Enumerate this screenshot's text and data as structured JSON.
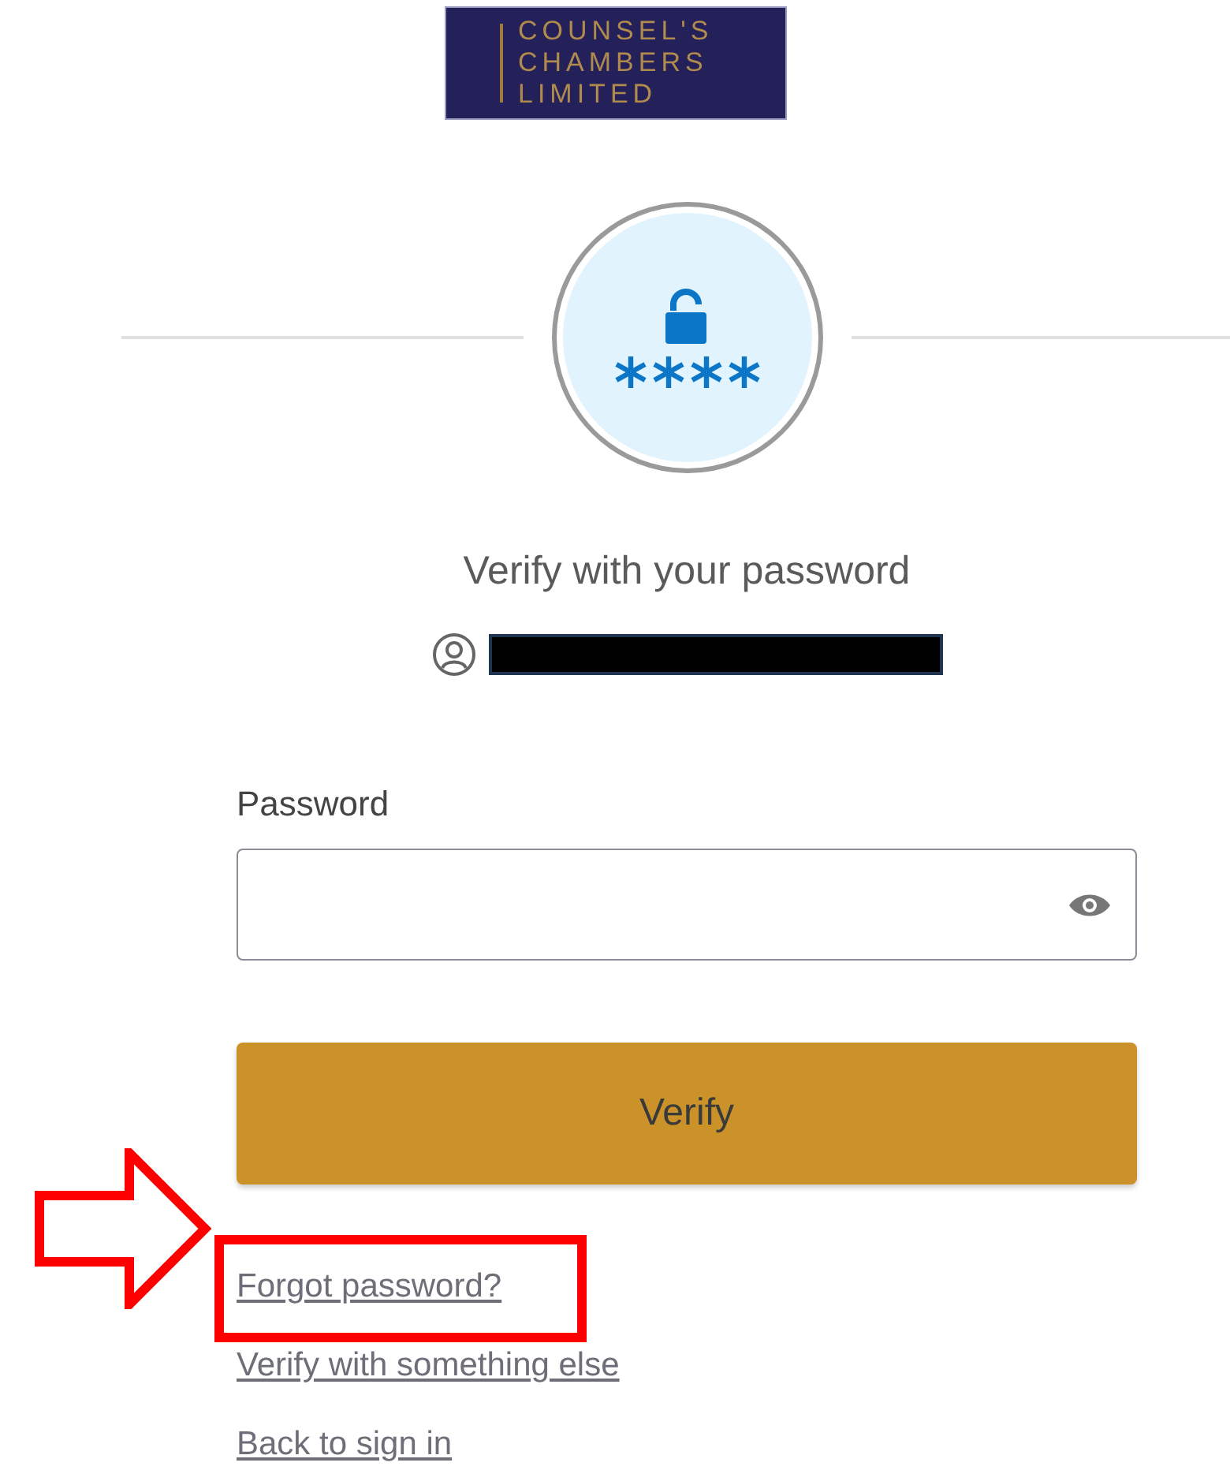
{
  "logo": {
    "lines": [
      "COUNSEL'S",
      "CHAMBERS",
      "LIMITED"
    ]
  },
  "title": "Verify with your password",
  "user": {
    "redacted": true
  },
  "password_field": {
    "label": "Password"
  },
  "verify_button": "Verify",
  "links": [
    {
      "label": "Forgot password?",
      "highlighted": true
    },
    {
      "label": "Verify with something else",
      "highlighted": false
    },
    {
      "label": "Back to sign in",
      "highlighted": false
    }
  ]
}
